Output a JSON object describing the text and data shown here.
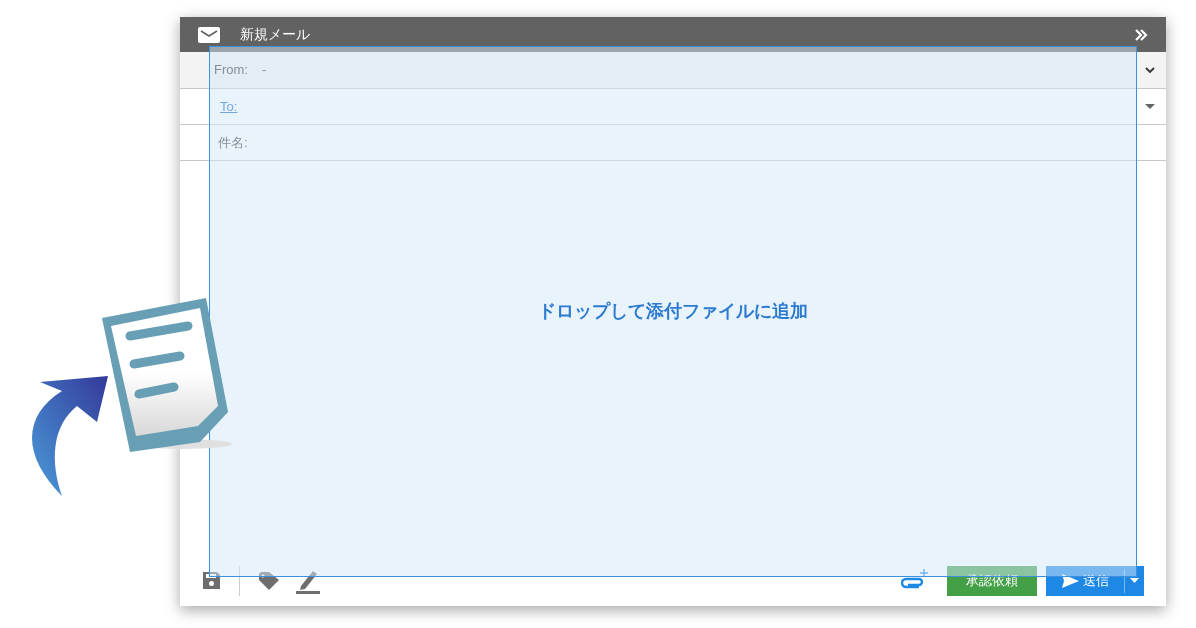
{
  "window": {
    "title": "新規メール"
  },
  "fields": {
    "from_label": "From:",
    "from_value": "-",
    "to_label": "To:",
    "subject_label": "件名:"
  },
  "drop_overlay": {
    "message": "ドロップして添付ファイルに追加"
  },
  "footer": {
    "approval_button": "承認依頼",
    "send_button": "送信"
  }
}
